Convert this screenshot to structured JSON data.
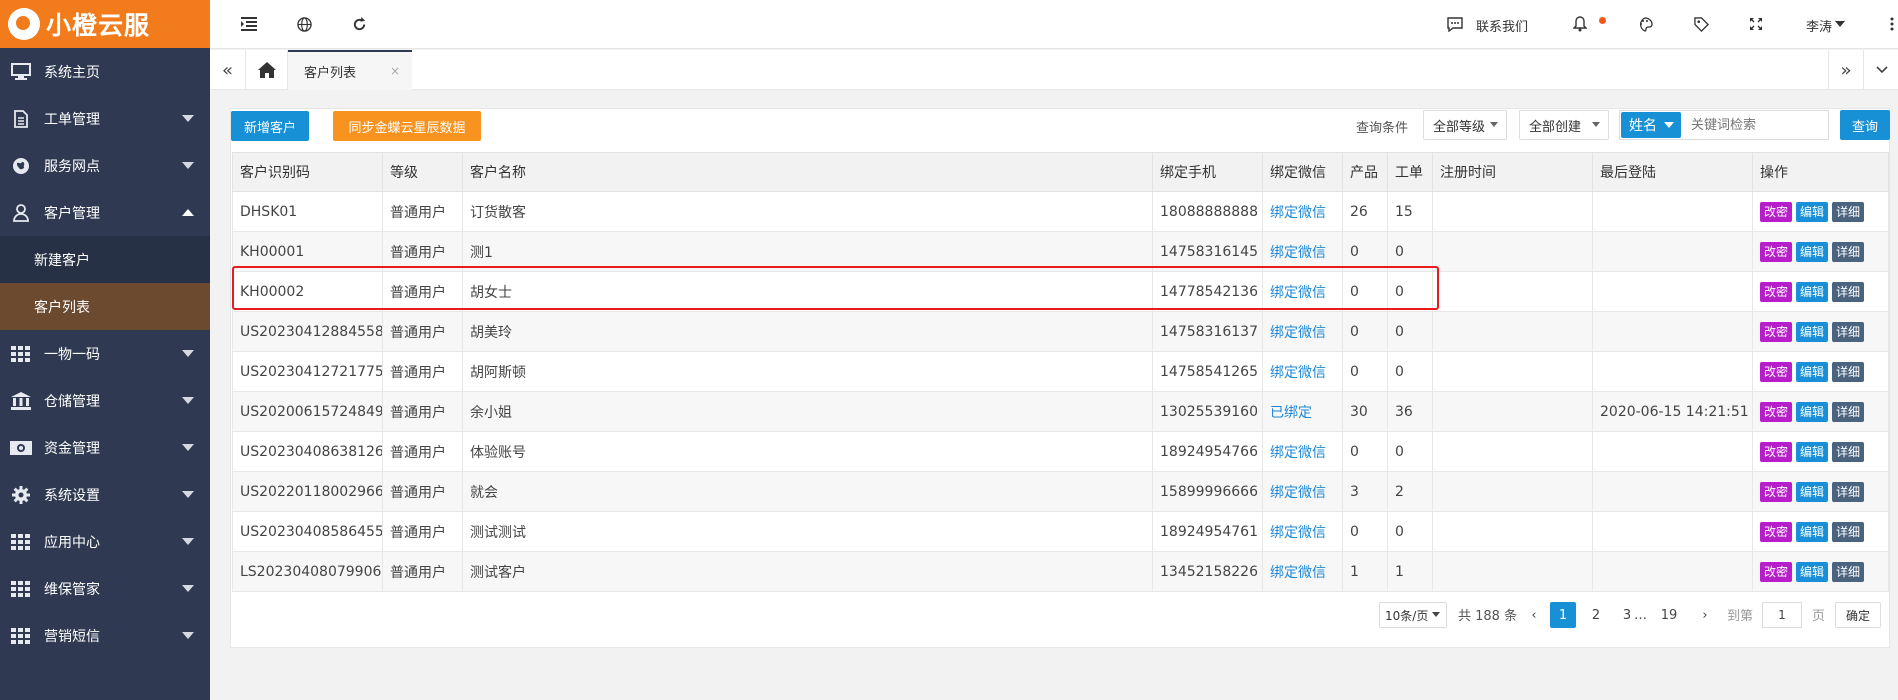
{
  "brand": {
    "name": "小橙云服"
  },
  "sidebar": {
    "items": [
      {
        "label": "系统主页",
        "icon": "monitor-icon"
      },
      {
        "label": "工单管理",
        "icon": "document-icon"
      },
      {
        "label": "服务网点",
        "icon": "globe-icon"
      },
      {
        "label": "客户管理",
        "icon": "user-icon",
        "expanded": true
      },
      {
        "label": "一物一码",
        "icon": "grid-icon"
      },
      {
        "label": "仓储管理",
        "icon": "bank-icon"
      },
      {
        "label": "资金管理",
        "icon": "money-icon"
      },
      {
        "label": "系统设置",
        "icon": "gear-icon"
      },
      {
        "label": "应用中心",
        "icon": "grid-icon"
      },
      {
        "label": "维保管家",
        "icon": "grid-icon"
      },
      {
        "label": "营销短信",
        "icon": "grid-icon"
      }
    ],
    "subitems": [
      {
        "label": "新建客户",
        "active": false
      },
      {
        "label": "客户列表",
        "active": true
      }
    ]
  },
  "topbar": {
    "contact_label": "联系我们",
    "user_name": "李涛"
  },
  "tabs": {
    "active_label": "客户列表",
    "close_symbol": "×"
  },
  "toolbar": {
    "new_customer": "新增客户",
    "sync_button": "同步金蝶云星辰数据",
    "query_label": "查询条件",
    "level_select": "全部等级",
    "create_select": "全部创建",
    "field_select": "姓名",
    "keyword_placeholder": "关键词检索",
    "search_button": "查询"
  },
  "table": {
    "headers": [
      "客户识别码",
      "等级",
      "客户名称",
      "绑定手机",
      "绑定微信",
      "产品",
      "工单",
      "注册时间",
      "最后登陆",
      "操作"
    ],
    "rows": [
      {
        "code": "DHSK01",
        "level": "普通用户",
        "name": "订货散客",
        "phone": "18088888888",
        "wechat": "绑定微信",
        "products": "26",
        "orders": "15",
        "registered": "",
        "last_login": ""
      },
      {
        "code": "KH00001",
        "level": "普通用户",
        "name": "测1",
        "phone": "14758316145",
        "wechat": "绑定微信",
        "products": "0",
        "orders": "0",
        "registered": "",
        "last_login": ""
      },
      {
        "code": "KH00002",
        "level": "普通用户",
        "name": "胡女士",
        "phone": "14778542136",
        "wechat": "绑定微信",
        "products": "0",
        "orders": "0",
        "registered": "",
        "last_login": ""
      },
      {
        "code": "US20230412884558",
        "level": "普通用户",
        "name": "胡美玲",
        "phone": "14758316137",
        "wechat": "绑定微信",
        "products": "0",
        "orders": "0",
        "registered": "",
        "last_login": ""
      },
      {
        "code": "US20230412721775",
        "level": "普通用户",
        "name": "胡阿斯顿",
        "phone": "14758541265",
        "wechat": "绑定微信",
        "products": "0",
        "orders": "0",
        "registered": "",
        "last_login": ""
      },
      {
        "code": "US20200615724849",
        "level": "普通用户",
        "name": "余小姐",
        "phone": "13025539160",
        "wechat": "已绑定",
        "products": "30",
        "orders": "36",
        "registered": "",
        "last_login": "2020-06-15 14:21:51"
      },
      {
        "code": "US20230408638126",
        "level": "普通用户",
        "name": "体验账号",
        "phone": "18924954766",
        "wechat": "绑定微信",
        "products": "0",
        "orders": "0",
        "registered": "",
        "last_login": ""
      },
      {
        "code": "US20220118002966",
        "level": "普通用户",
        "name": "就会",
        "phone": "15899996666",
        "wechat": "绑定微信",
        "products": "3",
        "orders": "2",
        "registered": "",
        "last_login": ""
      },
      {
        "code": "US20230408586455",
        "level": "普通用户",
        "name": "测试测试",
        "phone": "18924954761",
        "wechat": "绑定微信",
        "products": "0",
        "orders": "0",
        "registered": "",
        "last_login": ""
      },
      {
        "code": "LS20230408079906",
        "level": "普通用户",
        "name": "测试客户",
        "phone": "13452158226",
        "wechat": "绑定微信",
        "products": "1",
        "orders": "1",
        "registered": "",
        "last_login": ""
      }
    ],
    "actions": {
      "password": "改密",
      "edit": "编辑",
      "detail": "详细"
    }
  },
  "pagination": {
    "page_size": "10条/页",
    "total": "共 188 条",
    "prev": "‹",
    "next": "›",
    "pages": [
      "1",
      "2",
      "3"
    ],
    "ellipsis": "…",
    "last_page": "19",
    "goto_label": "到第",
    "current": "1",
    "page_suffix": "页",
    "confirm": "确定"
  },
  "colors": {
    "brand_orange": "#f27b1c",
    "sidebar_bg": "#2f3a52",
    "primary_blue": "#1890d6",
    "highlight_red": "#e81c1c"
  }
}
